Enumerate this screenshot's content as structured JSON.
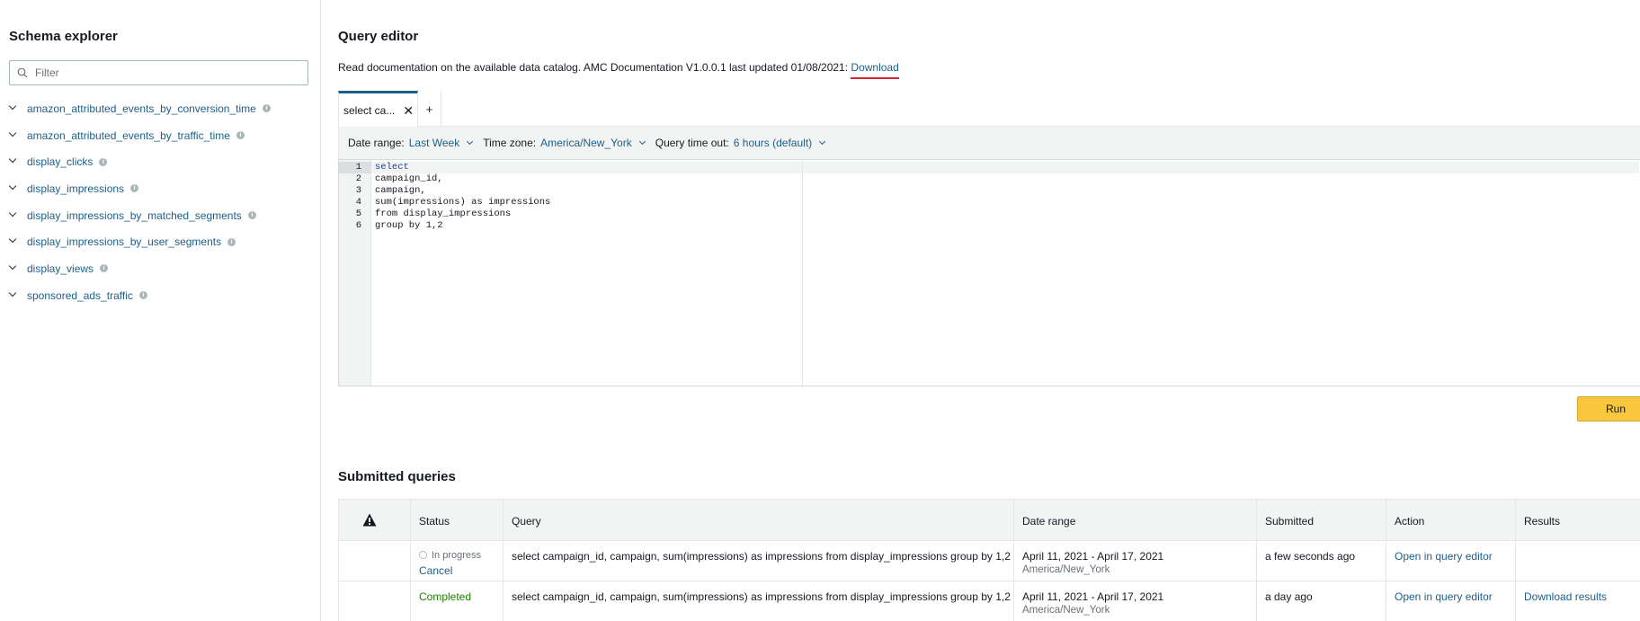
{
  "sidebar": {
    "title": "Schema explorer",
    "filter_placeholder": "Filter",
    "items": [
      {
        "label": "amazon_attributed_events_by_conversion_time"
      },
      {
        "label": "amazon_attributed_events_by_traffic_time"
      },
      {
        "label": "display_clicks"
      },
      {
        "label": "display_impressions"
      },
      {
        "label": "display_impressions_by_matched_segments"
      },
      {
        "label": "display_impressions_by_user_segments"
      },
      {
        "label": "display_views"
      },
      {
        "label": "sponsored_ads_traffic"
      }
    ]
  },
  "editor": {
    "title": "Query editor",
    "doc_text": "Read documentation on the available data catalog. AMC Documentation V1.0.0.1 last updated 01/08/2021: ",
    "doc_link": "Download",
    "tab_label": "select ca...",
    "tab_close": "✕",
    "tab_add": "+",
    "date_range_label": "Date range:",
    "date_range_value": "Last Week",
    "time_zone_label": "Time zone:",
    "time_zone_value": "America/New_York",
    "timeout_label": "Query time out:",
    "timeout_value": "6 hours (default)",
    "line_numbers": [
      "1",
      "2",
      "3",
      "4",
      "5",
      "6"
    ],
    "code_lines": [
      "select",
      "campaign_id,",
      "campaign,",
      "sum(impressions) as impressions",
      "from display_impressions",
      "group by 1,2"
    ],
    "run_label": "Run"
  },
  "submitted": {
    "title": "Submitted queries",
    "columns": [
      "Status",
      "Query",
      "Date range",
      "Submitted",
      "Action",
      "Results"
    ],
    "rows": [
      {
        "status": "In progress",
        "status_action": "Cancel",
        "query": "select campaign_id, campaign, sum(impressions) as impressions from display_impressions group by 1,2",
        "date_range": "April 11, 2021 - April 17, 2021",
        "time_zone": "America/New_York",
        "submitted": "a few seconds ago",
        "action": "Open in query editor",
        "results": ""
      },
      {
        "status": "Completed",
        "query": "select campaign_id, campaign, sum(impressions) as impressions from display_impressions group by 1,2",
        "date_range": "April 11, 2021 - April 17, 2021",
        "time_zone": "America/New_York",
        "submitted": "a day ago",
        "action": "Open in query editor",
        "results": "Download results"
      }
    ]
  },
  "colors": {
    "link": "#1b5f8a",
    "run_button": "#f8c73e",
    "completed": "#1d8102",
    "underline": "#d7262e"
  }
}
